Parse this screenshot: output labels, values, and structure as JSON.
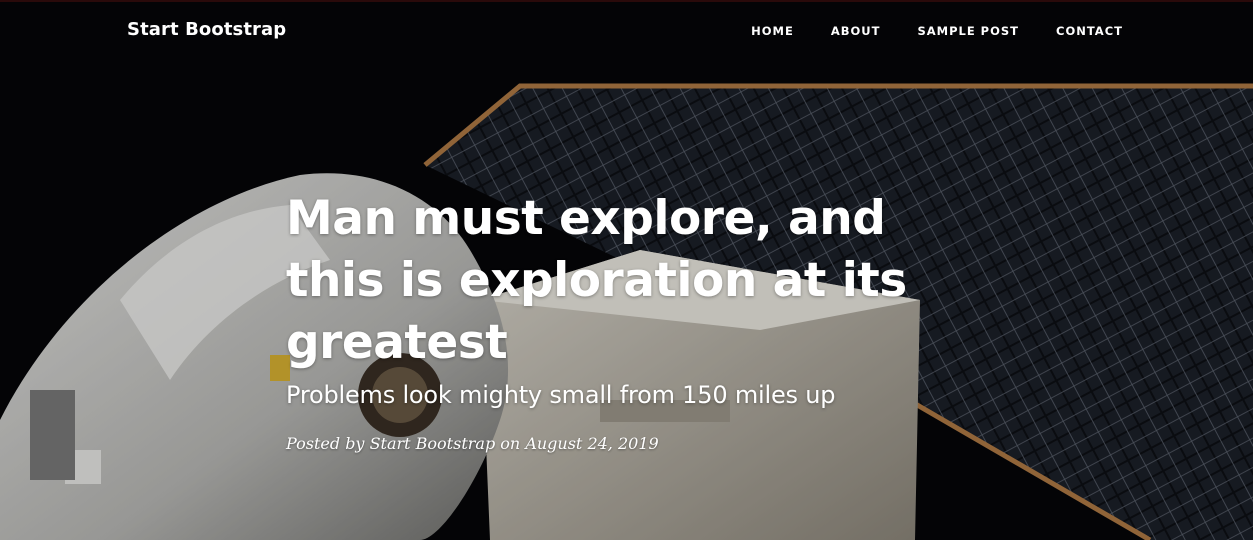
{
  "navbar": {
    "brand": "Start Bootstrap",
    "items": [
      {
        "label": "HOME"
      },
      {
        "label": "ABOUT"
      },
      {
        "label": "SAMPLE POST"
      },
      {
        "label": "CONTACT"
      }
    ]
  },
  "post": {
    "title": "Man must explore, and this is exploration at its greatest",
    "subtitle": "Problems look mighty small from 150 miles up",
    "meta": {
      "prefix": "Posted by",
      "author": "Start Bootstrap",
      "on": "on",
      "date": "August 24, 2019"
    }
  },
  "background": {
    "subject": "astronaut and solar panel array in space"
  }
}
